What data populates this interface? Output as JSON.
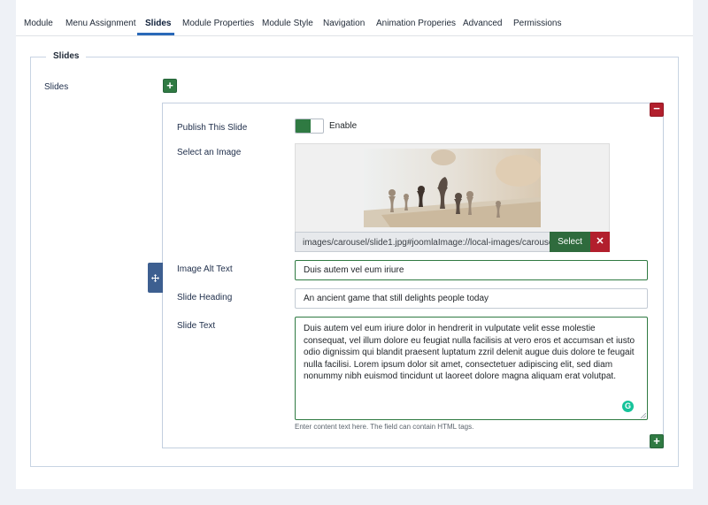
{
  "tabs": [
    {
      "label": "Module",
      "active": false
    },
    {
      "label": "Menu Assignment",
      "active": false
    },
    {
      "label": "Slides",
      "active": true
    },
    {
      "label": "Module Properties",
      "active": false
    },
    {
      "label": "Module Style",
      "active": false
    },
    {
      "label": "Navigation",
      "active": false
    },
    {
      "label": "Animation Properies",
      "active": false
    },
    {
      "label": "Advanced",
      "active": false
    },
    {
      "label": "Permissions",
      "active": false
    }
  ],
  "fieldset": {
    "legend": "Slides",
    "field_label": "Slides",
    "add_button": "+",
    "add_bottom_button": "+"
  },
  "slide": {
    "remove_button": "−",
    "drag_icon": "move-icon",
    "publish": {
      "label": "Publish This Slide",
      "state_label": "Enable",
      "enabled": true
    },
    "image": {
      "label": "Select an Image",
      "path": "images/carousel/slide1.jpg#joomlaImage://local-images/carousel/slide1.jpg",
      "select_label": "Select",
      "clear_label": "✕"
    },
    "alt_text": {
      "label": "Image Alt Text",
      "value": "Duis autem vel eum iriure"
    },
    "heading": {
      "label": "Slide Heading",
      "value": "An ancient game that still delights people today"
    },
    "text": {
      "label": "Slide Text",
      "value": "Duis autem vel eum iriure dolor in hendrerit in vulputate velit esse molestie consequat, vel illum dolore eu feugiat nulla facilisis at vero eros et accumsan et iusto odio dignissim qui blandit praesent luptatum zzril delenit augue duis dolore te feugait nulla facilisi. Lorem ipsum dolor sit amet, consectetuer adipiscing elit, sed diam nonummy nibh euismod tincidunt ut laoreet dolore magna aliquam erat volutpat.",
      "helper": "Enter content text here. The field can contain HTML tags."
    }
  },
  "colors": {
    "accent": "#2a69b8",
    "success": "#2f7a42",
    "danger": "#b21f2d",
    "handle": "#3d5f90"
  }
}
